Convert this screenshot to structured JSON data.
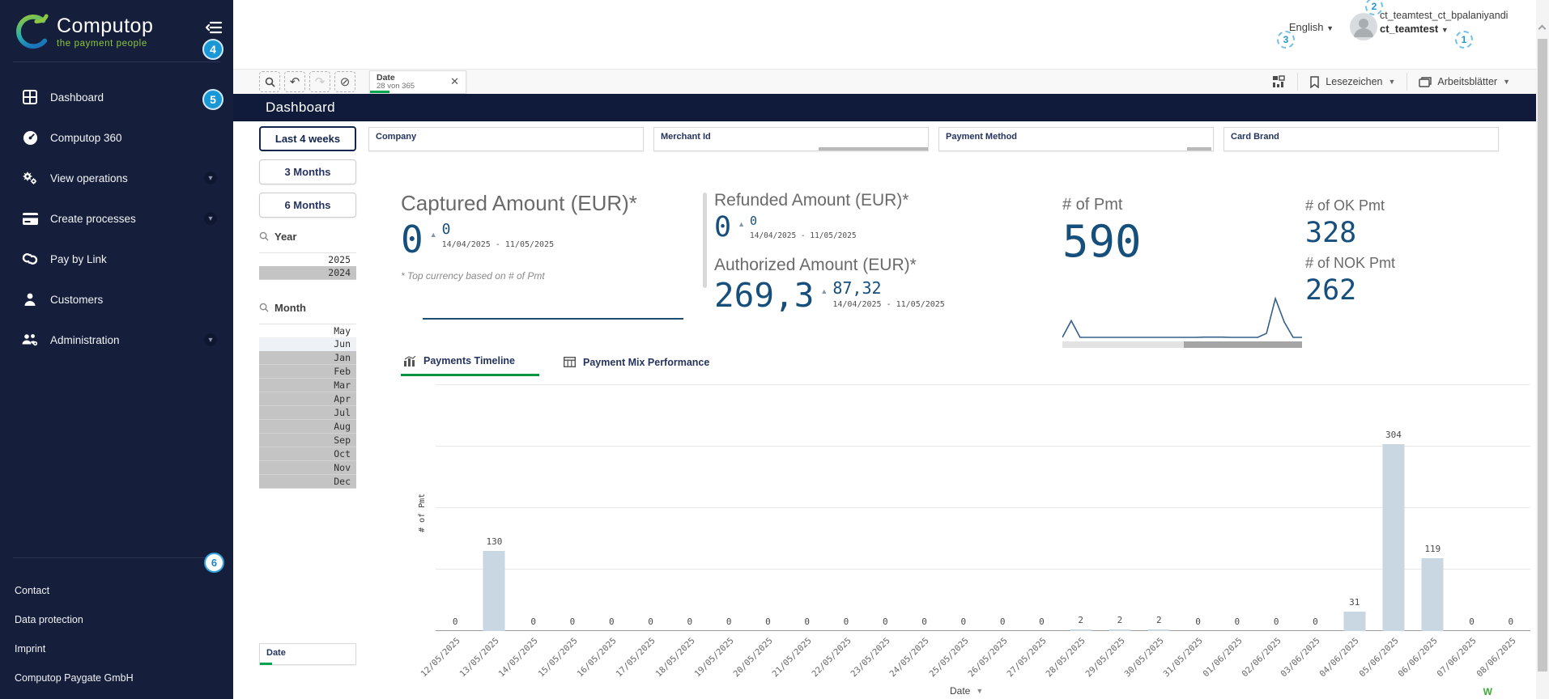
{
  "sidebar": {
    "logo_title": "Computop",
    "logo_subtitle": "the payment people",
    "nav": [
      {
        "label": "Dashboard"
      },
      {
        "label": "Computop 360"
      },
      {
        "label": "View operations"
      },
      {
        "label": "Create processes"
      },
      {
        "label": "Pay by Link"
      },
      {
        "label": "Customers"
      },
      {
        "label": "Administration"
      }
    ],
    "footer_links": [
      "Contact",
      "Data protection",
      "Imprint",
      "Computop Paygate GmbH"
    ]
  },
  "topbar": {
    "language": "English",
    "user_line1": "ct_teamtest_ct_bpalaniyandi",
    "user_line2": "ct_teamtest"
  },
  "toolbar": {
    "filter_chip": {
      "title": "Date",
      "subtitle": "28 von 365"
    },
    "bookmarks_label": "Lesezeichen",
    "sheets_label": "Arbeitsblätter"
  },
  "page": {
    "title": "Dashboard"
  },
  "quick_filters": [
    {
      "label": "Last 4 weeks",
      "active": true
    },
    {
      "label": "3 Months",
      "active": false
    },
    {
      "label": "6 Months",
      "active": false
    }
  ],
  "filter_fields": [
    {
      "label": "Company"
    },
    {
      "label": "Merchant Id"
    },
    {
      "label": "Payment Method"
    },
    {
      "label": "Card Brand"
    }
  ],
  "kpis": {
    "captured": {
      "title": "Captured Amount (EUR)*",
      "value": "0",
      "secondary": "0",
      "range": "14/04/2025 - 11/05/2025"
    },
    "refunded": {
      "title": "Refunded Amount (EUR)*",
      "value": "0",
      "secondary": "0",
      "range": "14/04/2025 - 11/05/2025"
    },
    "authorized": {
      "title": "Authorized Amount (EUR)*",
      "value": "269,3",
      "secondary": "87,32",
      "range": "14/04/2025 - 11/05/2025"
    },
    "pmt": {
      "title": "# of Pmt",
      "value": "590"
    },
    "ok": {
      "title": "# of OK Pmt",
      "value": "328"
    },
    "nok": {
      "title": "# of NOK Pmt",
      "value": "262"
    },
    "footnote": "* Top currency based on # of Pmt"
  },
  "side_filters": {
    "year": {
      "label": "Year",
      "items": [
        {
          "label": "2025",
          "state": "white"
        },
        {
          "label": "2024",
          "state": "grey"
        }
      ]
    },
    "month": {
      "label": "Month",
      "items": [
        {
          "label": "May",
          "state": "white"
        },
        {
          "label": "Jun",
          "state": "light"
        },
        {
          "label": "Jan",
          "state": "grey"
        },
        {
          "label": "Feb",
          "state": "grey"
        },
        {
          "label": "Mar",
          "state": "grey"
        },
        {
          "label": "Apr",
          "state": "grey"
        },
        {
          "label": "Jul",
          "state": "grey"
        },
        {
          "label": "Aug",
          "state": "grey"
        },
        {
          "label": "Sep",
          "state": "grey"
        },
        {
          "label": "Oct",
          "state": "grey"
        },
        {
          "label": "Nov",
          "state": "grey"
        },
        {
          "label": "Dec",
          "state": "grey"
        }
      ]
    },
    "date_box_label": "Date"
  },
  "tabs": [
    {
      "label": "Payments Timeline",
      "active": true
    },
    {
      "label": "Payment Mix Performance",
      "active": false
    }
  ],
  "chart_data": {
    "type": "bar",
    "title": "Payments Timeline",
    "xlabel": "Date",
    "ylabel": "# of Pmt",
    "ylim": [
      0,
      400
    ],
    "gridlines": [
      100,
      200,
      300,
      400
    ],
    "legend_position": "none",
    "bar_color": "#c9d7e2",
    "categories": [
      "12/05/2025",
      "13/05/2025",
      "14/05/2025",
      "15/05/2025",
      "16/05/2025",
      "17/05/2025",
      "18/05/2025",
      "19/05/2025",
      "20/05/2025",
      "21/05/2025",
      "22/05/2025",
      "23/05/2025",
      "24/05/2025",
      "25/05/2025",
      "26/05/2025",
      "27/05/2025",
      "28/05/2025",
      "29/05/2025",
      "30/05/2025",
      "31/05/2025",
      "01/06/2025",
      "02/06/2025",
      "03/06/2025",
      "04/06/2025",
      "05/06/2025",
      "06/06/2025",
      "07/06/2025",
      "08/06/2025"
    ],
    "values": [
      0,
      130,
      0,
      0,
      0,
      0,
      0,
      0,
      0,
      0,
      0,
      0,
      0,
      0,
      0,
      0,
      2,
      2,
      2,
      0,
      0,
      0,
      0,
      31,
      304,
      119,
      0,
      0
    ]
  },
  "annotations": [
    "1",
    "2",
    "3",
    "4",
    "5",
    "6"
  ],
  "corner_mark": "W"
}
